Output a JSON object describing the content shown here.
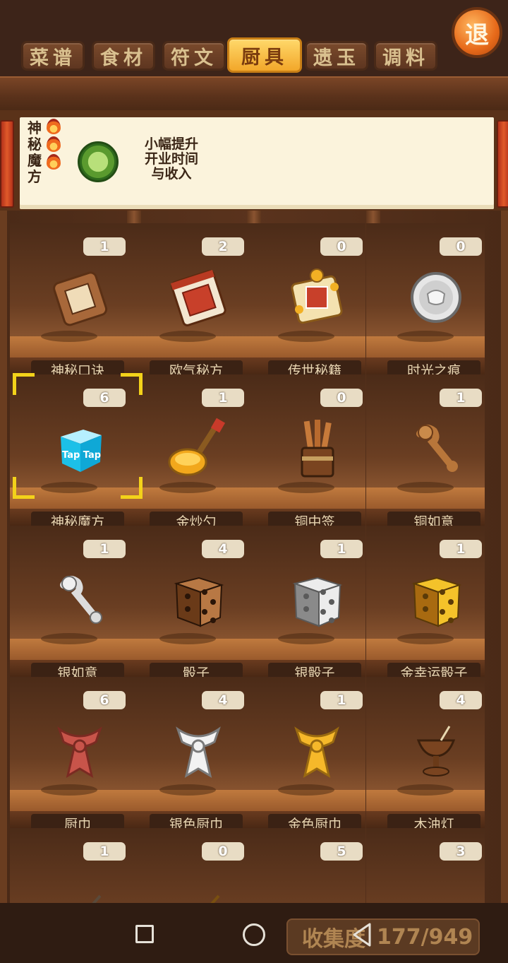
{
  "tabs": [
    {
      "label": "菜谱",
      "active": false
    },
    {
      "label": "食材",
      "active": false
    },
    {
      "label": "符文",
      "active": false
    },
    {
      "label": "厨具",
      "active": true
    },
    {
      "label": "遗玉",
      "active": false
    },
    {
      "label": "调料",
      "active": false
    }
  ],
  "exit_label": "退",
  "detail": {
    "name_chars": [
      "神",
      "秘",
      "魔",
      "方"
    ],
    "flame_count": 3,
    "effect_lines": [
      "小幅提升",
      "开业时间",
      "与收入"
    ]
  },
  "items": [
    {
      "name": "神秘口诀",
      "count": "1",
      "icon": "secret-scroll-brown-icon"
    },
    {
      "name": "欧气秘方",
      "count": "2",
      "icon": "secret-scroll-red-icon"
    },
    {
      "name": "传世秘籍",
      "count": "0",
      "icon": "secret-book-gold-icon"
    },
    {
      "name": "时光之痕",
      "count": "0",
      "icon": "silver-coin-icon"
    },
    {
      "name": "神秘魔方",
      "count": "6",
      "icon": "taptap-cube-icon",
      "icon_text": "Tap Tap",
      "selected": true
    },
    {
      "name": "金炒勺",
      "count": "1",
      "icon": "golden-ladle-icon"
    },
    {
      "name": "铜中签",
      "count": "0",
      "icon": "bronze-sticks-icon"
    },
    {
      "name": "铜如意",
      "count": "1",
      "icon": "bronze-ruyi-icon"
    },
    {
      "name": "银如意",
      "count": "1",
      "icon": "silver-ruyi-icon"
    },
    {
      "name": "骰子",
      "count": "4",
      "icon": "wooden-dice-icon"
    },
    {
      "name": "银骰子",
      "count": "1",
      "icon": "silver-dice-icon"
    },
    {
      "name": "金幸运骰子",
      "count": "1",
      "icon": "golden-dice-icon"
    },
    {
      "name": "厨巾",
      "count": "6",
      "icon": "red-scarf-icon"
    },
    {
      "name": "银色厨巾",
      "count": "4",
      "icon": "silver-scarf-icon"
    },
    {
      "name": "金色厨巾",
      "count": "1",
      "icon": "golden-scarf-icon"
    },
    {
      "name": "木油灯",
      "count": "4",
      "icon": "oil-lamp-icon"
    },
    {
      "name": "",
      "count": "1",
      "icon": "white-bowl-icon"
    },
    {
      "name": "",
      "count": "0",
      "icon": "golden-bowl-icon"
    },
    {
      "name": "",
      "count": "5",
      "icon": "golden-item-icon"
    },
    {
      "name": "",
      "count": "3",
      "icon": "grey-pot-icon"
    }
  ],
  "collection": {
    "label": "收集度",
    "value": "177/949"
  },
  "colors": {
    "active_tab": "#f2a72a",
    "selection": "#f3d21a",
    "shelf_wood": "#5a331d"
  }
}
